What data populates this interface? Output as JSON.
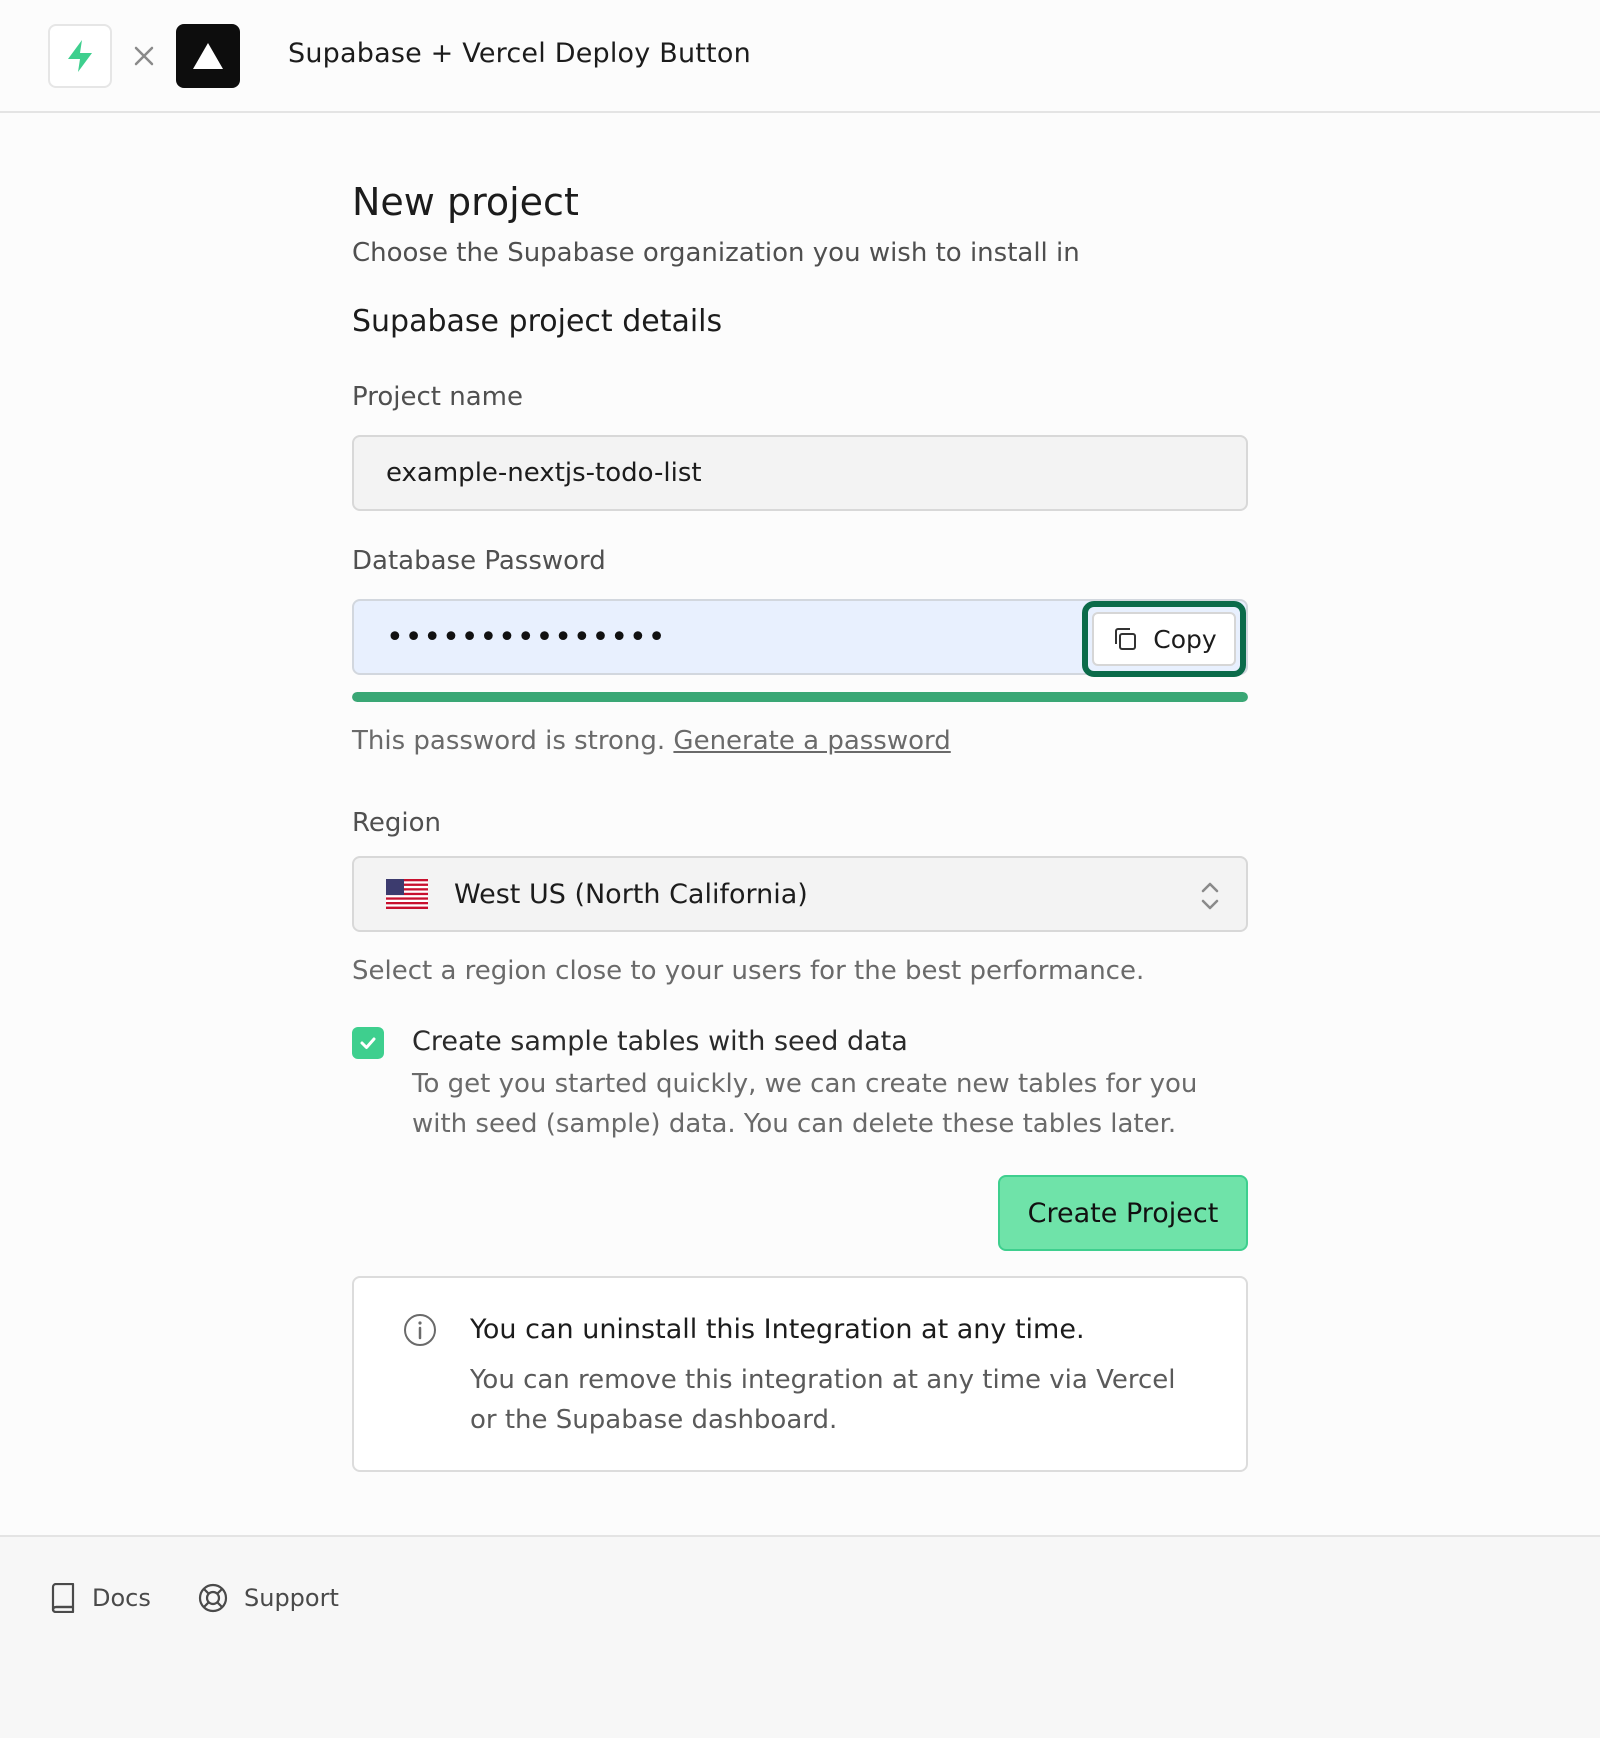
{
  "header": {
    "title": "Supabase + Vercel Deploy Button",
    "logos": {
      "left": "supabase-logo",
      "separator": "close-icon",
      "right": "vercel-logo"
    }
  },
  "main": {
    "title": "New project",
    "subtitle": "Choose the Supabase organization you wish to install in",
    "section_title": "Supabase project details",
    "project_name": {
      "label": "Project name",
      "value": "example-nextjs-todo-list"
    },
    "password": {
      "label": "Database Password",
      "masked_value": "•••••••••••••••",
      "copy_label": "Copy",
      "strength_fraction": 1.0,
      "strength_text": "This password is strong.",
      "generate_link": "Generate a password"
    },
    "region": {
      "label": "Region",
      "value": "West US (North California)",
      "flag": "us-flag-icon",
      "help": "Select a region close to your users for the best performance."
    },
    "seed": {
      "checked": true,
      "title": "Create sample tables with seed data",
      "description": "To get you started quickly, we can create new tables for you with seed (sample) data. You can delete these tables later."
    },
    "create_button": "Create Project",
    "notice": {
      "title": "You can uninstall this Integration at any time.",
      "body": "You can remove this integration at any time via Vercel or the Supabase dashboard."
    }
  },
  "footer": {
    "docs": "Docs",
    "support": "Support"
  },
  "colors": {
    "brand_green": "#3ecf8e",
    "focus_ring": "#0b6b4a",
    "strength": "#3aa775"
  }
}
